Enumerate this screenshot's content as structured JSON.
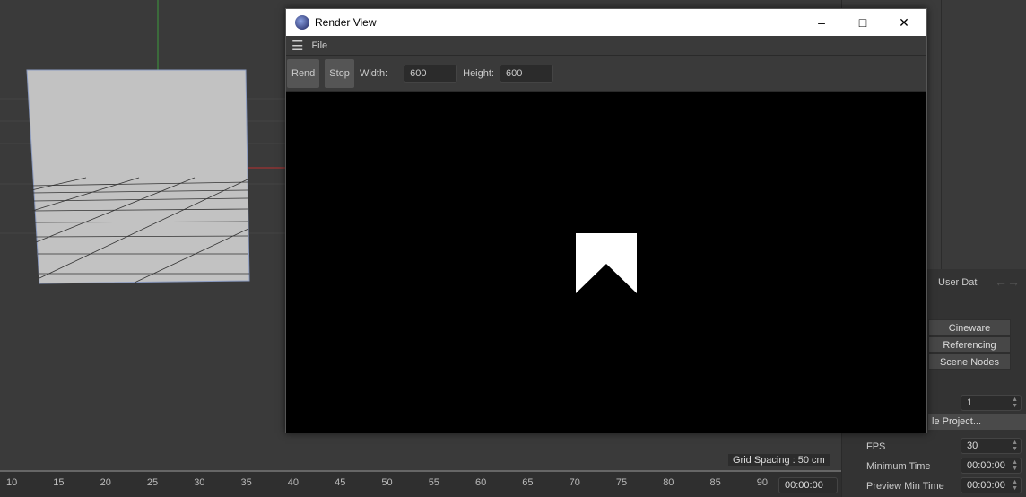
{
  "render_view": {
    "title": "Render View",
    "menu": {
      "file": "File"
    },
    "toolbar": {
      "render": "Rend",
      "stop": "Stop",
      "width_label": "Width:",
      "width_value": "600",
      "height_label": "Height:",
      "height_value": "600"
    }
  },
  "viewport": {
    "grid_spacing": "Grid Spacing : 50 cm"
  },
  "timeline": {
    "ticks": [
      "10",
      "15",
      "20",
      "25",
      "30",
      "35",
      "40",
      "45",
      "50",
      "55",
      "60",
      "65",
      "70",
      "75",
      "80",
      "85",
      "90"
    ],
    "current_time": "00:00:00"
  },
  "attributes": {
    "user_data_tab": "User Dat",
    "tabs": [
      "Cineware",
      "Referencing",
      "Scene Nodes"
    ],
    "scale_value": "1",
    "scale_project_button": "le Project...",
    "fps_label": "FPS",
    "fps_value": "30",
    "min_time_label": "Minimum Time",
    "min_time_value": "00:00:00",
    "preview_min_label": "Preview Min Time",
    "preview_min_value": "00:00:00"
  }
}
